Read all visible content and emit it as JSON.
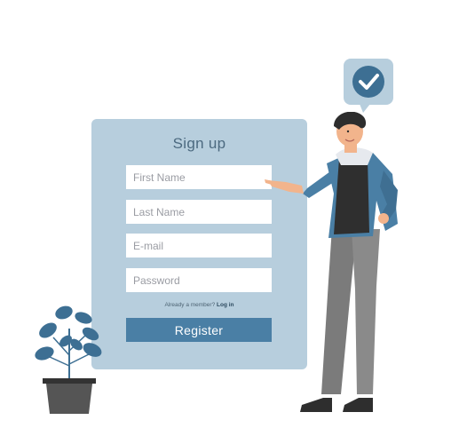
{
  "form": {
    "title": "Sign up",
    "fields": [
      {
        "name": "first-name",
        "placeholder": "First Name",
        "value": ""
      },
      {
        "name": "last-name",
        "placeholder": "Last Name",
        "value": ""
      },
      {
        "name": "email",
        "placeholder": "E-mail",
        "value": ""
      },
      {
        "name": "password",
        "placeholder": "Password",
        "value": ""
      }
    ],
    "member_prompt": "Already a member?",
    "login_link": "Log in",
    "register_label": "Register"
  },
  "icons": {
    "bubble": "checkmark-icon",
    "decor": [
      "person-illustration",
      "potted-plant-illustration"
    ]
  },
  "colors": {
    "panel": "#b7cedd",
    "title": "#4c6a80",
    "button": "#4a7fa5",
    "check_bubble": "#b7cedd",
    "check_circle": "#3d6f93"
  }
}
